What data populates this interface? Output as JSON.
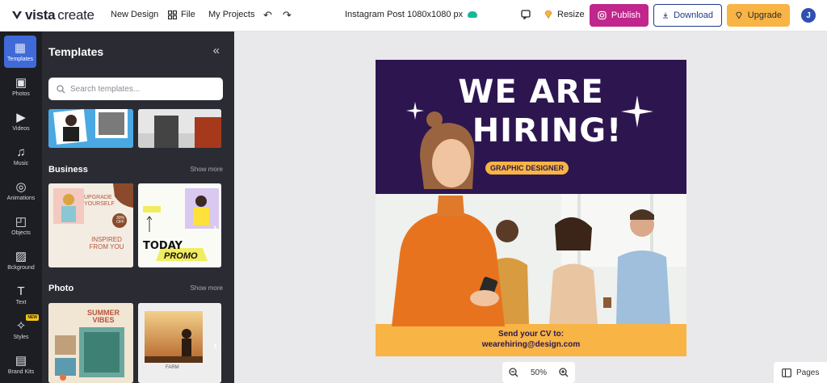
{
  "topbar": {
    "logo_brand": "vista",
    "logo_product": "create",
    "new_design": "New Design",
    "file": "File",
    "my_projects": "My Projects",
    "doc_title": "Instagram Post 1080x1080 px",
    "resize": "Resize",
    "publish": "Publish",
    "download": "Download",
    "upgrade": "Upgrade",
    "avatar_initial": "J"
  },
  "rail": {
    "items": [
      {
        "label": "Templates",
        "icon": "templates-icon",
        "active": true
      },
      {
        "label": "Photos",
        "icon": "photos-icon"
      },
      {
        "label": "Videos",
        "icon": "videos-icon"
      },
      {
        "label": "Music",
        "icon": "music-icon"
      },
      {
        "label": "Animations",
        "icon": "animations-icon"
      },
      {
        "label": "Objects",
        "icon": "objects-icon"
      },
      {
        "label": "Bckground",
        "icon": "background-icon"
      },
      {
        "label": "Text",
        "icon": "text-icon"
      },
      {
        "label": "Styles",
        "icon": "styles-icon",
        "badge": "NEW"
      },
      {
        "label": "Brand Kits",
        "icon": "brand-kits-icon"
      }
    ]
  },
  "panel": {
    "title": "Templates",
    "search_placeholder": "Search templates...",
    "sections": [
      {
        "label": "Business",
        "show_more": "Show more"
      },
      {
        "label": "Photo",
        "show_more": "Show more"
      }
    ],
    "business_thumb_1": {
      "line1": "UPGRADE",
      "line2": "YOURSELF",
      "line3": "INSPIRED",
      "line4": "FROM YOU",
      "badge": "30% OFF"
    },
    "business_thumb_2": {
      "line1": "TODAY",
      "line2": "PROMO"
    },
    "photo_thumb_1": {
      "line1": "SUMMER",
      "line2": "VIBES"
    },
    "photo_thumb_2": {
      "line1": "FARM"
    }
  },
  "poster": {
    "headline_1": "WE ARE",
    "headline_2": "HIRING!",
    "role": "GRAPHIC DESIGNER",
    "cv_line1": "Send your CV to:",
    "cv_line2": "wearehiring@design.com"
  },
  "zoom": {
    "value": "50%"
  },
  "pages": {
    "label": "Pages"
  },
  "colors": {
    "accent": "#3f6ad8",
    "poster_purple": "#2d1650",
    "poster_yellow": "#f8b445",
    "publish": "#c0268c"
  }
}
